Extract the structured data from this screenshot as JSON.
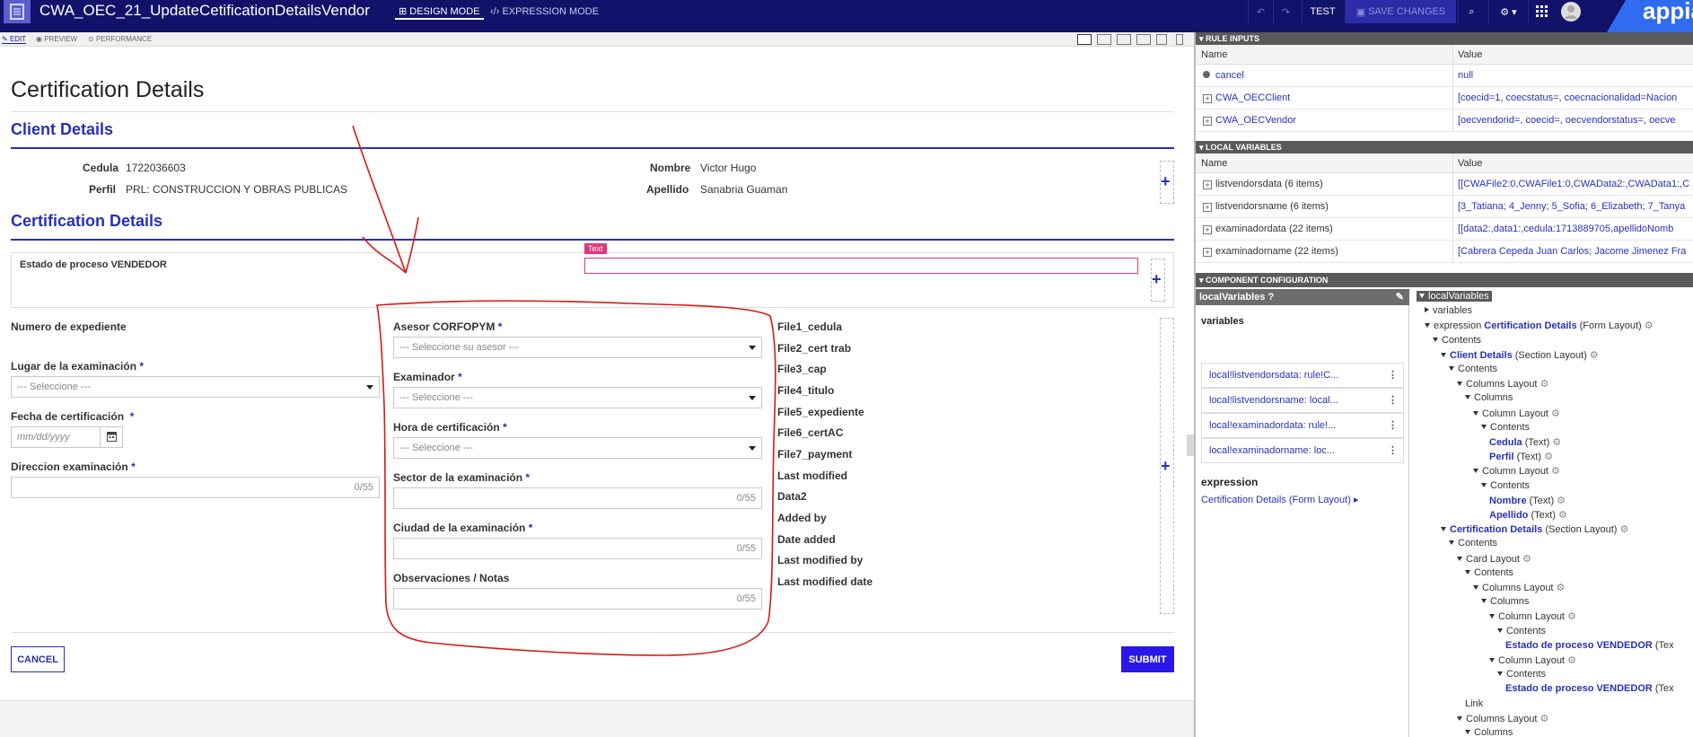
{
  "topbar": {
    "title": "CWA_OEC_21_UpdateCetificationDetailsVendor",
    "design_mode": "DESIGN MODE",
    "expression_mode": "EXPRESSION MODE",
    "test": "TEST",
    "save": "SAVE CHANGES",
    "brand": "appia"
  },
  "subtabs": {
    "edit": "EDIT",
    "preview": "PREVIEW",
    "performance": "PERFORMANCE"
  },
  "form": {
    "title": "Certification Details",
    "client_section": "Client Details",
    "cedula_label": "Cedula",
    "cedula_value": "1722036603",
    "perfil_label": "Perfil",
    "perfil_value": "PRL: CONSTRUCCION Y OBRAS PUBLICAS",
    "nombre_label": "Nombre",
    "nombre_value": "Victor Hugo",
    "apellido_label": "Apellido",
    "apellido_value": "Sanabria Guaman",
    "cert_section": "Certification Details",
    "estado_label": "Estado de proceso VENDEDOR",
    "text_tag": "Text",
    "numero_label": "Numero de expediente",
    "lugar_label": "Lugar de la examinación",
    "lugar_placeholder": "--- Seleccione ---",
    "fecha_label": "Fecha de certificación",
    "fecha_placeholder": "mm/dd/yyyy",
    "direccion_label": "Direccion examinación",
    "direccion_counter": "0/55",
    "asesor_label": "Asesor CORFOPYM",
    "asesor_placeholder": "--- Seleccione su asesor ---",
    "examinador_label": "Examinador",
    "examinador_placeholder": "--- Seleccione ---",
    "hora_label": "Hora de certificación",
    "hora_placeholder": "--- Seleccione ---",
    "sector_label": "Sector de la examinación",
    "sector_counter": "0/55",
    "ciudad_label": "Ciudad de la examinación",
    "ciudad_counter": "0/55",
    "obs_label": "Observaciones / Notas",
    "obs_counter": "0/55",
    "required_mark": "*",
    "right_fields": [
      "File1_cedula",
      "File2_cert trab",
      "File3_cap",
      "File4_titulo",
      "File5_expediente",
      "File6_certAC",
      "File7_payment",
      "Last modified",
      "Data2",
      "Added by",
      "Date added",
      "Last modified by",
      "Last modified date"
    ],
    "cancel": "CANCEL",
    "submit": "SUBMIT"
  },
  "rule_inputs": {
    "header": "RULE INPUTS",
    "col_name": "Name",
    "col_value": "Value",
    "rows": [
      {
        "name": "cancel",
        "value": "null"
      },
      {
        "name": "CWA_OECClient",
        "value": "[coecid=1, coecstatus=, coecnacionalidad=Nacion"
      },
      {
        "name": "CWA_OECVendor",
        "value": "[oecvendorid=, coecid=, oecvendorstatus=, oecve"
      }
    ]
  },
  "local_variables": {
    "header": "LOCAL VARIABLES",
    "col_name": "Name",
    "col_value": "Value",
    "rows": [
      {
        "name": "listvendorsdata (6 items)",
        "value": "[[CWAFile2:0,CWAFile1:0,CWAData2:,CWAData1:,C"
      },
      {
        "name": "listvendorsname (6 items)",
        "value": "[3_Tatiana; 4_Jenny; 5_Sofia; 6_Elizabeth; 7_Tanya"
      },
      {
        "name": "examinadordata (22 items)",
        "value": "[[data2:,data1:,cedula:1713889705,apellidoNomb"
      },
      {
        "name": "examinadorname (22 items)",
        "value": "[Cabrera Cepeda Juan Carlos; Jacome Jimenez Fra"
      }
    ]
  },
  "component_config": {
    "header": "COMPONENT CONFIGURATION",
    "local_variables_title": "localVariables",
    "variables_label": "variables",
    "vars": [
      "local!listvendorsdata: rule!C...",
      "local!listvendorsname: local...",
      "local!examinadordata: rule!...",
      "local!examinadorname: loc..."
    ],
    "expression_label": "expression",
    "expression_link": "Certification Details (Form Layout)",
    "tree": [
      {
        "indent": 0,
        "prefix": "",
        "blue": "localVariables",
        "suffix": "",
        "open": true,
        "gear": false
      },
      {
        "indent": 1,
        "prefix": "variables",
        "blue": "",
        "suffix": "",
        "open": false,
        "gear": false
      },
      {
        "indent": 1,
        "prefix": "expression ",
        "blue": "Certification Details",
        "suffix": " (Form Layout)",
        "open": true,
        "gear": true
      },
      {
        "indent": 2,
        "prefix": "Contents",
        "blue": "",
        "suffix": "",
        "open": true,
        "gear": false
      },
      {
        "indent": 3,
        "prefix": "",
        "blue": "Client Details",
        "suffix": " (Section Layout)",
        "open": true,
        "gear": true
      },
      {
        "indent": 4,
        "prefix": "Contents",
        "blue": "",
        "suffix": "",
        "open": true,
        "gear": false
      },
      {
        "indent": 5,
        "prefix": "Columns Layout",
        "blue": "",
        "suffix": "",
        "open": true,
        "gear": true
      },
      {
        "indent": 6,
        "prefix": "Columns",
        "blue": "",
        "suffix": "",
        "open": true,
        "gear": false
      },
      {
        "indent": 7,
        "prefix": "Column Layout",
        "blue": "",
        "suffix": "",
        "open": true,
        "gear": true
      },
      {
        "indent": 8,
        "prefix": "Contents",
        "blue": "",
        "suffix": "",
        "open": true,
        "gear": false
      },
      {
        "indent": 9,
        "prefix": "",
        "blue": "Cedula",
        "suffix": " (Text)",
        "open": null,
        "gear": true
      },
      {
        "indent": 9,
        "prefix": "",
        "blue": "Perfil",
        "suffix": " (Text)",
        "open": null,
        "gear": true
      },
      {
        "indent": 7,
        "prefix": "Column Layout",
        "blue": "",
        "suffix": "",
        "open": true,
        "gear": true
      },
      {
        "indent": 8,
        "prefix": "Contents",
        "blue": "",
        "suffix": "",
        "open": true,
        "gear": false
      },
      {
        "indent": 9,
        "prefix": "",
        "blue": "Nombre",
        "suffix": " (Text)",
        "open": null,
        "gear": true
      },
      {
        "indent": 9,
        "prefix": "",
        "blue": "Apellido",
        "suffix": " (Text)",
        "open": null,
        "gear": true
      },
      {
        "indent": 3,
        "prefix": "",
        "blue": "Certification Details",
        "suffix": " (Section Layout)",
        "open": true,
        "gear": true
      },
      {
        "indent": 4,
        "prefix": "Contents",
        "blue": "",
        "suffix": "",
        "open": true,
        "gear": false
      },
      {
        "indent": 5,
        "prefix": "Card Layout",
        "blue": "",
        "suffix": "",
        "open": true,
        "gear": true
      },
      {
        "indent": 6,
        "prefix": "Contents",
        "blue": "",
        "suffix": "",
        "open": true,
        "gear": false
      },
      {
        "indent": 7,
        "prefix": "Columns Layout",
        "blue": "",
        "suffix": "",
        "open": true,
        "gear": true
      },
      {
        "indent": 8,
        "prefix": "Columns",
        "blue": "",
        "suffix": "",
        "open": true,
        "gear": false
      },
      {
        "indent": 9,
        "prefix": "Column Layout",
        "blue": "",
        "suffix": "",
        "open": true,
        "gear": true
      },
      {
        "indent": 10,
        "prefix": "Contents",
        "blue": "",
        "suffix": "",
        "open": true,
        "gear": false
      },
      {
        "indent": 11,
        "prefix": "",
        "blue": "Estado de proceso VENDEDOR",
        "suffix": " (Tex",
        "open": null,
        "gear": false
      },
      {
        "indent": 9,
        "prefix": "Column Layout",
        "blue": "",
        "suffix": "",
        "open": true,
        "gear": true
      },
      {
        "indent": 10,
        "prefix": "Contents",
        "blue": "",
        "suffix": "",
        "open": true,
        "gear": false
      },
      {
        "indent": 11,
        "prefix": "",
        "blue": "Estado de proceso VENDEDOR",
        "suffix": " (Tex",
        "open": null,
        "gear": false
      },
      {
        "indent": 6,
        "prefix": "Link",
        "blue": "",
        "suffix": "",
        "open": null,
        "gear": false
      },
      {
        "indent": 5,
        "prefix": "Columns Layout",
        "blue": "",
        "suffix": "",
        "open": true,
        "gear": true
      },
      {
        "indent": 6,
        "prefix": "Columns",
        "blue": "",
        "suffix": "",
        "open": true,
        "gear": false
      }
    ]
  },
  "colors": {
    "accent": "#2830b8",
    "topbar": "#12126b",
    "submit": "#2a18e8",
    "annotation": "#d81818",
    "text_tag": "#e0377a"
  }
}
